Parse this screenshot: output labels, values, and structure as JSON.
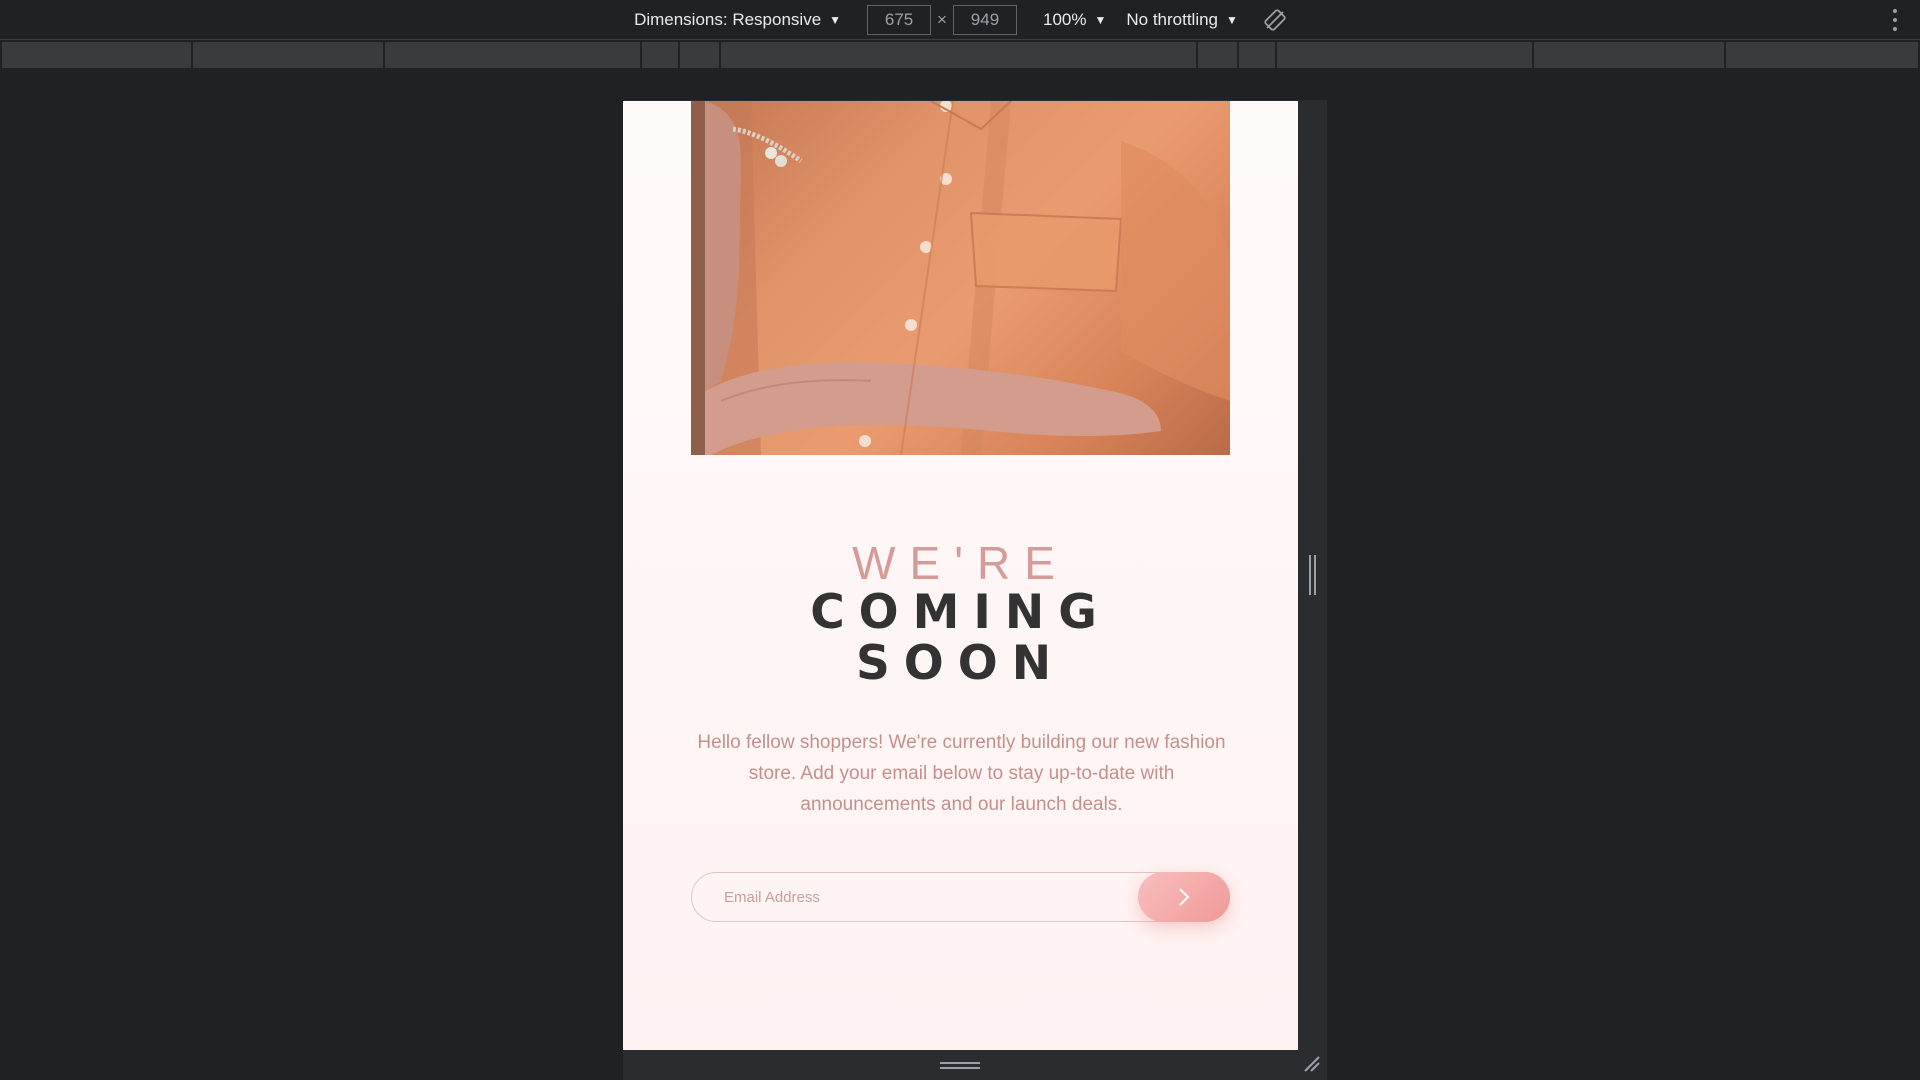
{
  "toolbar": {
    "dimensions_label": "Dimensions: Responsive",
    "width_value": "675",
    "times": "×",
    "height_value": "949",
    "zoom_label": "100%",
    "throttling_label": "No throttling",
    "dropdown_icon": "caret-down-icon",
    "rotate_icon": "rotate-icon",
    "more_icon": "more-vert-icon"
  },
  "page": {
    "title_top": "WE'RE",
    "title_line1": "COMING",
    "title_line2": "SOON",
    "description": "Hello fellow shoppers! We're currently building our new fashion store. Add your email below to stay up-to-date with announcements and our launch deals.",
    "email_placeholder": "Email Address",
    "submit_icon": "chevron-right-icon"
  },
  "colors": {
    "accent": "#f09a98",
    "title_dark": "#333333",
    "title_light": "#d49b98",
    "text_muted": "#c4908d"
  }
}
